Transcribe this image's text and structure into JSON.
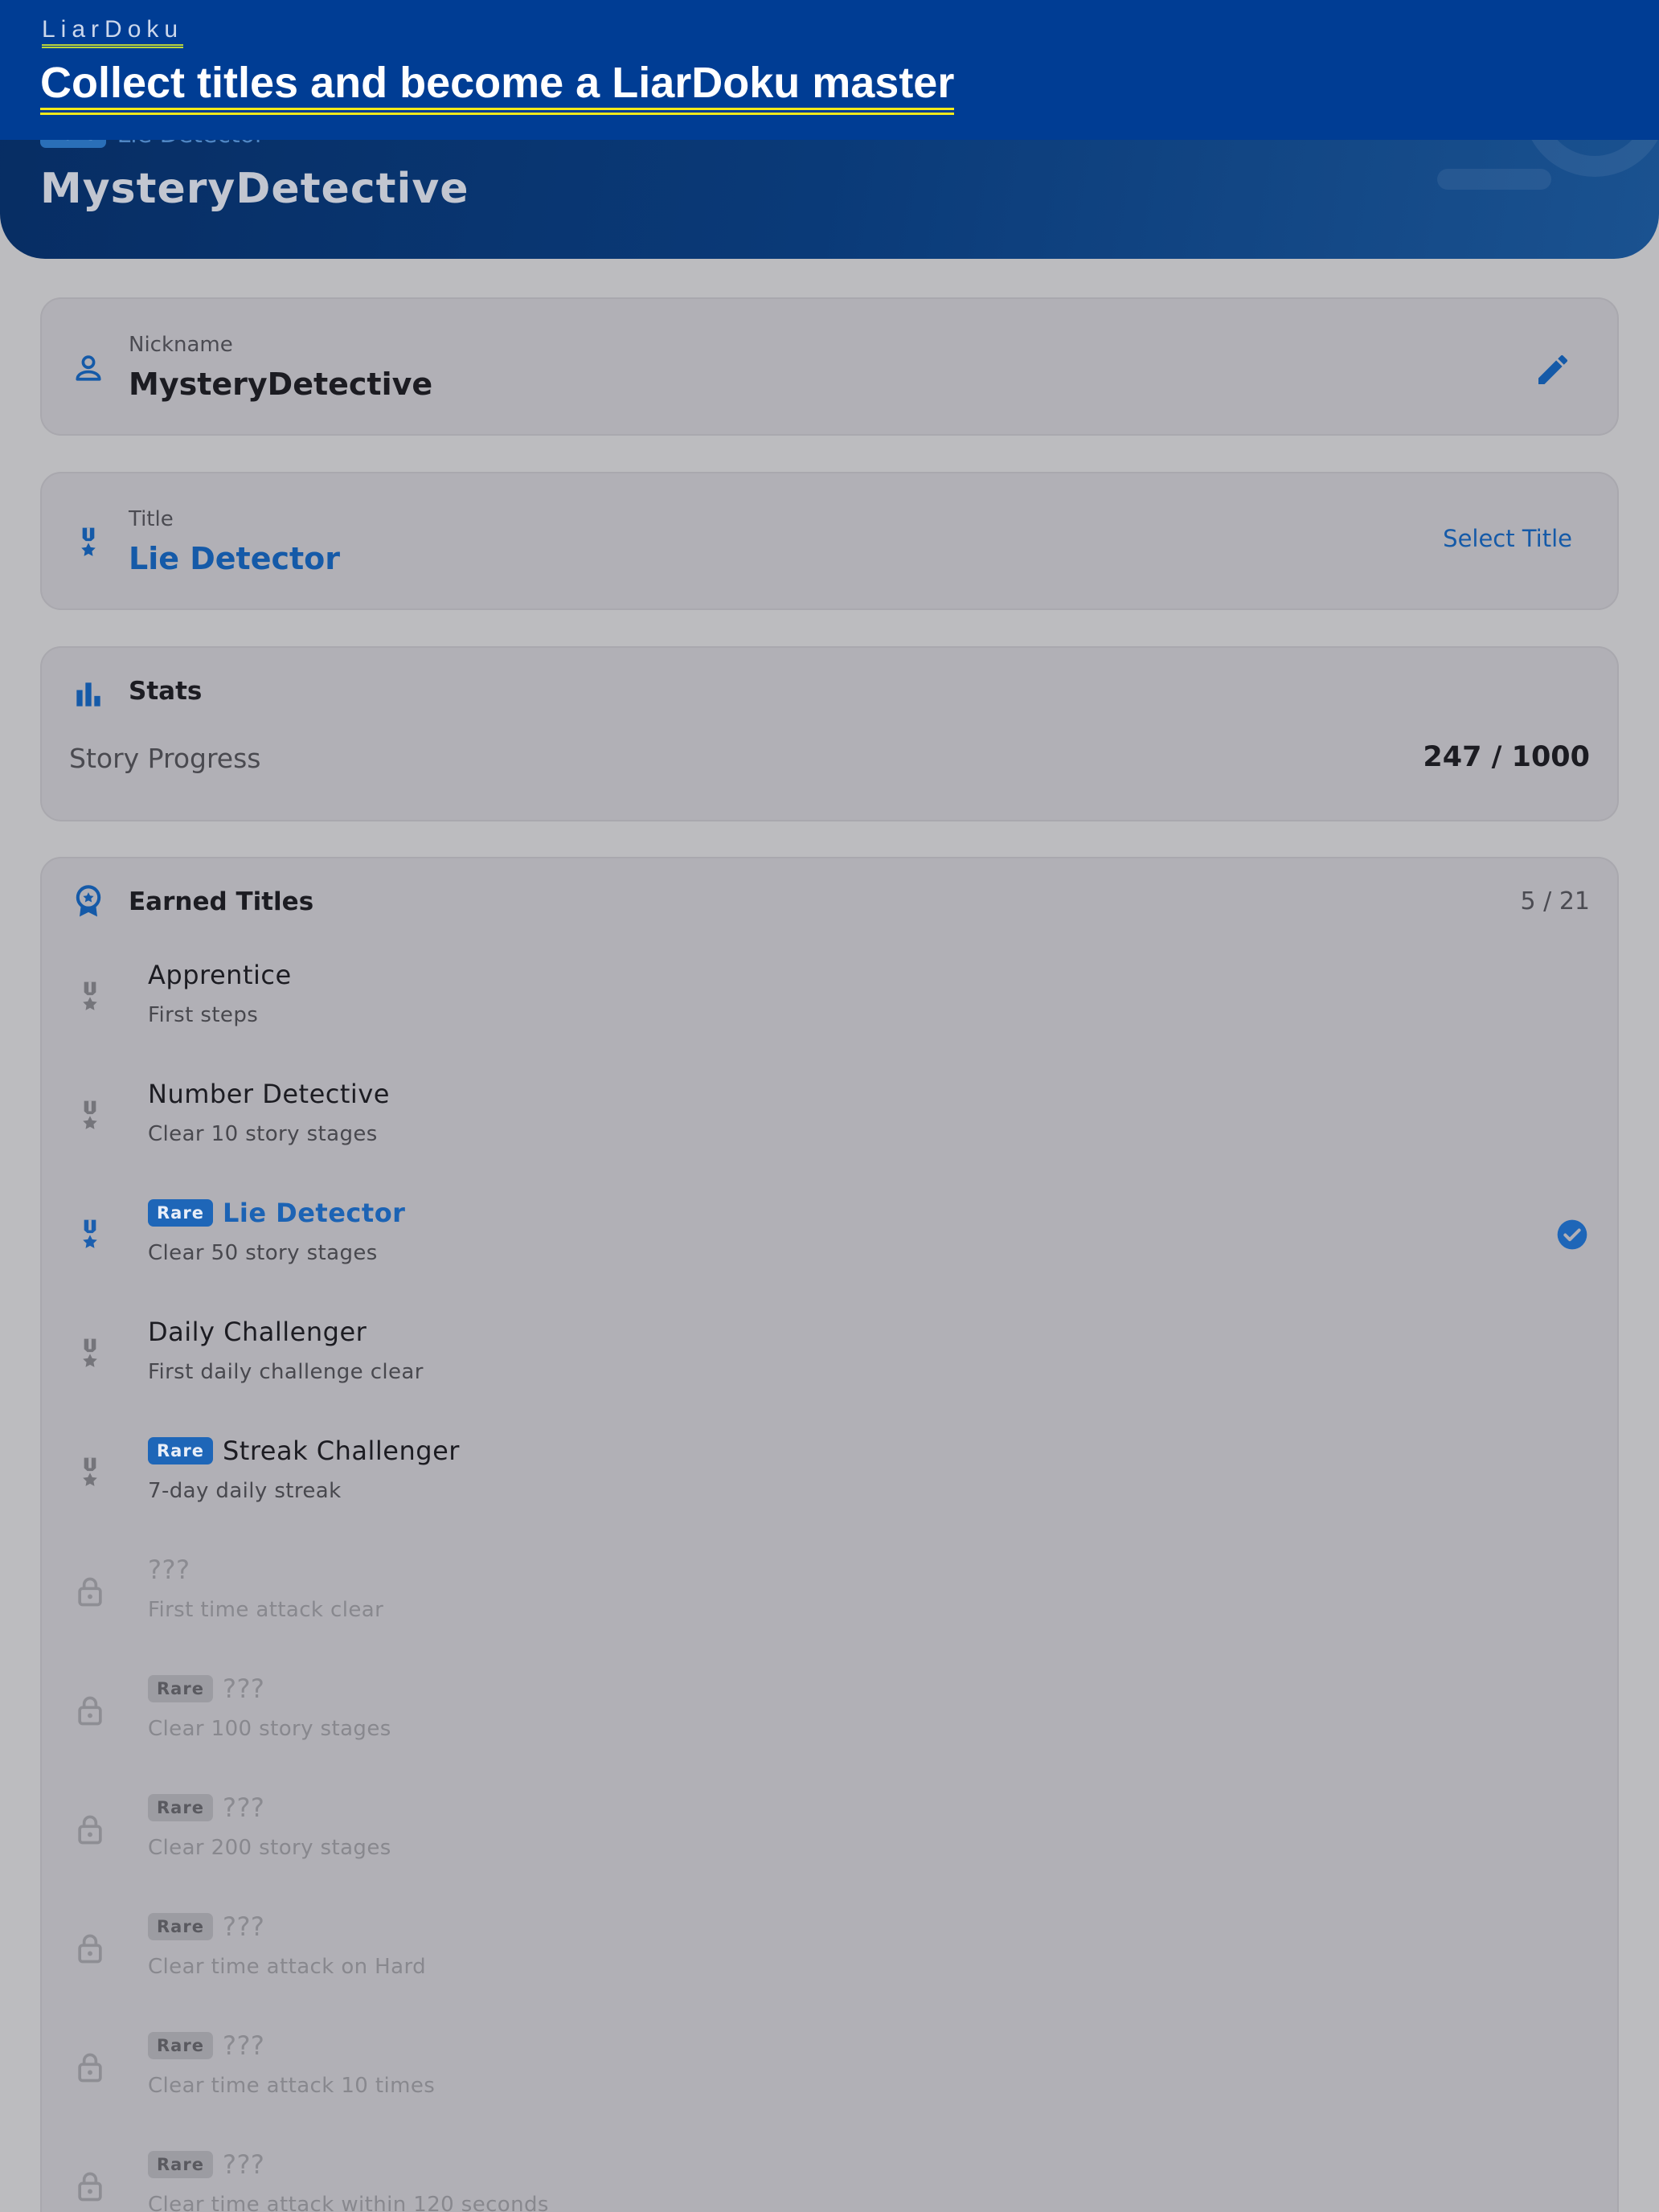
{
  "banner": {
    "brand": "LiarDoku",
    "headline": "Collect titles and become a LiarDoku master"
  },
  "profile_header": {
    "rare_badge": "Rare",
    "title": "Lie Detector",
    "nickname": "MysteryDetective"
  },
  "nickname_card": {
    "label": "Nickname",
    "value": "MysteryDetective",
    "icon": "person-icon",
    "action_icon": "pencil-icon"
  },
  "title_card": {
    "label": "Title",
    "value": "Lie Detector",
    "action": "Select Title",
    "icon": "medal-icon"
  },
  "stats_card": {
    "heading": "Stats",
    "story_label": "Story Progress",
    "story_value": "247 / 1000",
    "icon": "bar-chart-icon"
  },
  "titles_card": {
    "heading": "Earned Titles",
    "count": "5 / 21",
    "icon": "award-ribbon-icon",
    "items": [
      {
        "name": "Apprentice",
        "desc": "First steps",
        "rare": "",
        "state": "earned"
      },
      {
        "name": "Number Detective",
        "desc": "Clear 10 story stages",
        "rare": "",
        "state": "earned"
      },
      {
        "name": "Lie Detector",
        "desc": "Clear 50 story stages",
        "rare": "Rare",
        "state": "selected"
      },
      {
        "name": "Daily Challenger",
        "desc": "First daily challenge clear",
        "rare": "",
        "state": "earned"
      },
      {
        "name": "Streak Challenger",
        "desc": "7-day daily streak",
        "rare": "Rare",
        "state": "earned"
      },
      {
        "name": "???",
        "desc": "First time attack clear",
        "rare": "",
        "state": "locked"
      },
      {
        "name": "???",
        "desc": "Clear 100 story stages",
        "rare": "Rare",
        "state": "locked"
      },
      {
        "name": "???",
        "desc": "Clear 200 story stages",
        "rare": "Rare",
        "state": "locked"
      },
      {
        "name": "???",
        "desc": "Clear time attack on Hard",
        "rare": "Rare",
        "state": "locked"
      },
      {
        "name": "???",
        "desc": "Clear time attack 10 times",
        "rare": "Rare",
        "state": "locked"
      },
      {
        "name": "???",
        "desc": "Clear time attack within 120 seconds",
        "rare": "Rare",
        "state": "locked"
      }
    ]
  },
  "colors": {
    "accent": "#155aa8",
    "banner": "#003d94",
    "locked": "#8b8b91"
  }
}
